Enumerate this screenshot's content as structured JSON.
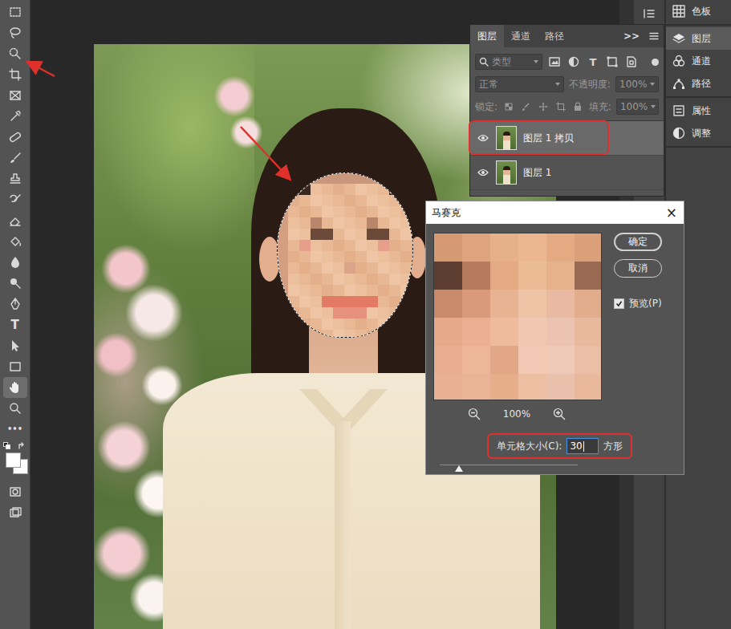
{
  "toolbar": {
    "tools": [
      {
        "kind": "marquee",
        "selected": false
      },
      {
        "kind": "lasso",
        "selected": false
      },
      {
        "kind": "quickselect",
        "selected": false
      },
      {
        "kind": "crop",
        "selected": false
      },
      {
        "kind": "frame",
        "selected": false
      },
      {
        "kind": "eyedropper",
        "selected": false
      },
      {
        "kind": "healing",
        "selected": false
      },
      {
        "kind": "brush",
        "selected": false
      },
      {
        "kind": "stamp",
        "selected": false
      },
      {
        "kind": "history",
        "selected": false
      },
      {
        "kind": "eraser",
        "selected": false
      },
      {
        "kind": "bucket",
        "selected": false
      },
      {
        "kind": "blur",
        "selected": false
      },
      {
        "kind": "dodge",
        "selected": false
      },
      {
        "kind": "pen",
        "selected": false
      },
      {
        "kind": "type",
        "glyph": "T",
        "selected": false
      },
      {
        "kind": "pathselect",
        "selected": false
      },
      {
        "kind": "rectangle",
        "selected": false
      },
      {
        "kind": "hand",
        "selected": true
      },
      {
        "kind": "zoom",
        "selected": false
      },
      {
        "kind": "more",
        "glyph": "•••",
        "selected": false
      }
    ],
    "colors": {
      "foreground": "#ffffff",
      "background": "#ffffff"
    }
  },
  "layers_panel": {
    "tabs": [
      {
        "label": "图层",
        "selected": true
      },
      {
        "label": "通道",
        "selected": false
      },
      {
        "label": "路径",
        "selected": false
      }
    ],
    "more": ">>",
    "filter": {
      "label": "类型"
    },
    "filters": [
      {
        "kind": "pixel"
      },
      {
        "kind": "adjust"
      },
      {
        "kind": "type",
        "glyph": "T"
      },
      {
        "kind": "shape"
      },
      {
        "kind": "smart"
      }
    ],
    "options_disabled": true,
    "blend_mode": "正常",
    "opacity_label": "不透明度:",
    "opacity": "100%",
    "lock_label": "锁定:",
    "fill_label": "填充:",
    "fill": "100%",
    "layers": [
      {
        "name": "图层 1 拷贝",
        "selected": true,
        "visible": true,
        "highlighted": true
      },
      {
        "name": "图层 1",
        "selected": false,
        "visible": true,
        "highlighted": false
      }
    ]
  },
  "dock": {
    "groups": [
      [
        {
          "label": "色板",
          "kind": "swatches",
          "selected": false
        }
      ],
      [
        {
          "label": "图层",
          "kind": "layers",
          "selected": true
        },
        {
          "label": "通道",
          "kind": "channels",
          "selected": false
        },
        {
          "label": "路径",
          "kind": "paths",
          "selected": false
        }
      ],
      [
        {
          "label": "属性",
          "kind": "properties",
          "selected": false
        },
        {
          "label": "调整",
          "kind": "adjustments",
          "selected": false
        }
      ]
    ]
  },
  "dialog": {
    "title": "马赛克",
    "close": "×",
    "buttons": [
      {
        "label": "确定",
        "default": true
      },
      {
        "label": "取消",
        "default": false
      }
    ],
    "preview": {
      "label": "预览(P)",
      "checked": true
    },
    "zoom": "100%",
    "cell_size": {
      "label": "单元格大小(C):",
      "value": "30",
      "unit": "方形",
      "level": 0.14,
      "highlighted": true
    }
  }
}
